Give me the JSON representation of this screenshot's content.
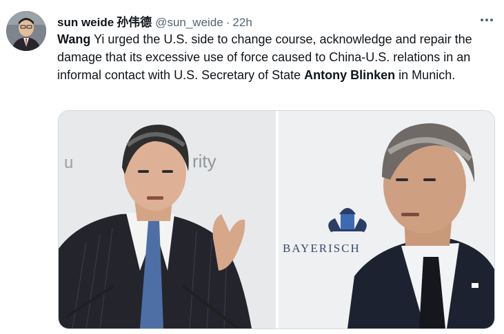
{
  "tweet": {
    "author": {
      "display_name": "sun weide",
      "display_name_cjk": "孙伟德",
      "handle": "@sun_weide",
      "separator": "·",
      "time": "22h"
    },
    "more_icon": "ellipsis-horizontal-icon",
    "text": {
      "part1_bold": "Wang",
      "part2": " Yi urged the U.S. side to change course, acknowledge and repair the damage that its excessive use of force caused to China-U.S. relations in an informal contact with U.S. Secretary of State ",
      "part3_bold": "Antony Blinken",
      "part4": " in Munich."
    },
    "media": {
      "left_photo_visible_text": "rity",
      "left_photo_visible_text_edge": "u",
      "right_photo_visible_text": "BAYERISCH"
    }
  },
  "colors": {
    "text_primary": "#0f1419",
    "text_secondary": "#536471",
    "border": "#cfd9de"
  }
}
